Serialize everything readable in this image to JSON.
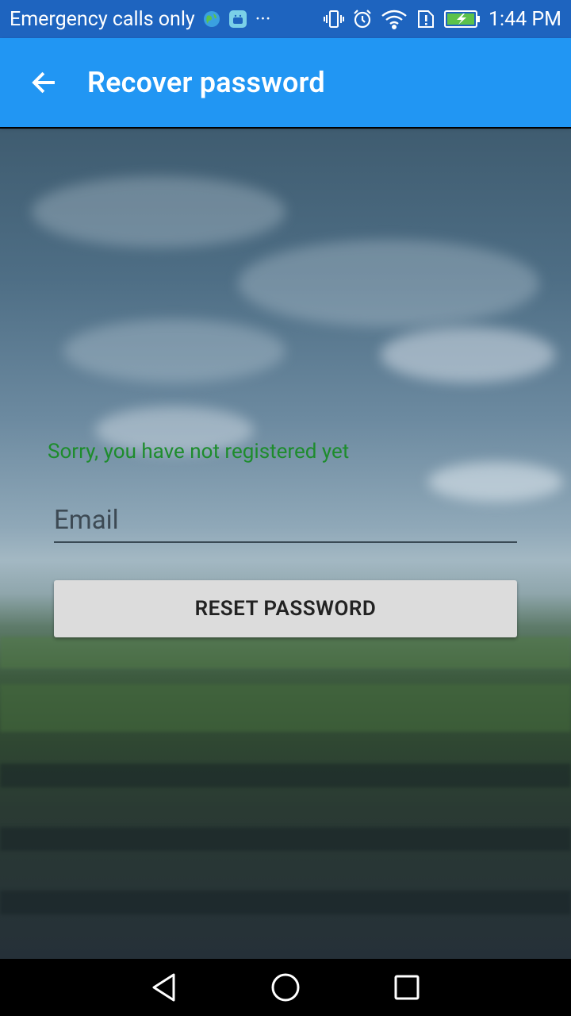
{
  "status_bar": {
    "carrier_text": "Emergency calls only",
    "time": "1:44 PM",
    "icons": [
      "globe-icon",
      "android-icon",
      "more-icon",
      "vibrate-icon",
      "alarm-icon",
      "wifi-icon",
      "sim-alert-icon",
      "battery-charging-icon"
    ],
    "more_glyph": "···"
  },
  "app_bar": {
    "title": "Recover password",
    "back_icon": "arrow-back-icon",
    "color": "#2196f3"
  },
  "form": {
    "error_message": "Sorry, you have not registered yet",
    "error_color": "#1d8c2c",
    "email_placeholder": "Email",
    "email_value": "",
    "reset_button_label": "RESET PASSWORD"
  },
  "nav_bar": {
    "icons": [
      "back-triangle-icon",
      "home-circle-icon",
      "recents-square-icon"
    ]
  }
}
